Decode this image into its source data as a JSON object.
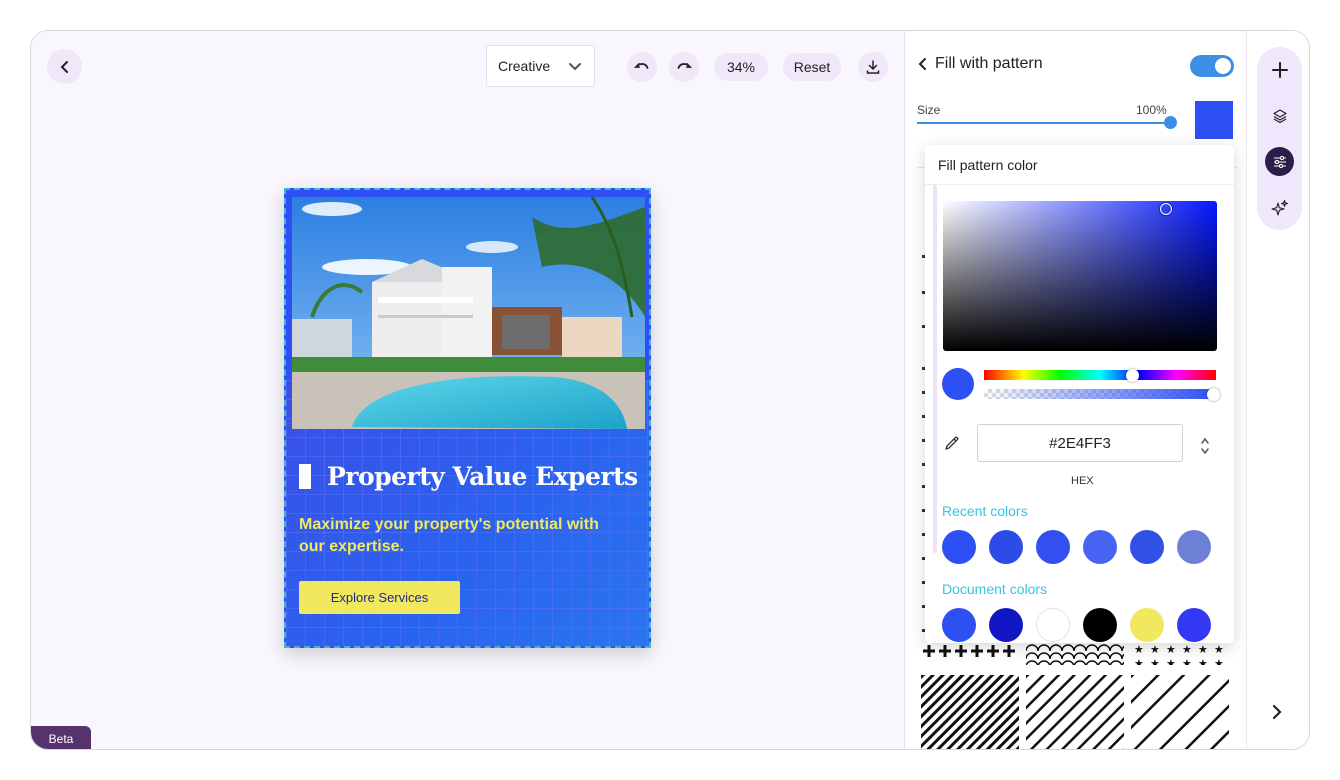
{
  "toolbar": {
    "template_select": "Creative",
    "zoom": "34%",
    "reset_label": "Reset"
  },
  "design": {
    "headline": "Property Value Experts",
    "subtitle": "Maximize your property's potential with our expertise.",
    "cta_label": "Explore Services",
    "accent_color": "#2e4ff3",
    "text_accent_color": "#f2e85f"
  },
  "beta_label": "Beta",
  "panel": {
    "title": "Fill with pattern",
    "toggle_on": true,
    "size_label": "Size",
    "size_value": "100%",
    "size_fraction": 1.0,
    "fill_color": "#2E4FF3"
  },
  "color_picker": {
    "title": "Fill pattern color",
    "hex_value": "#2E4FF3",
    "hex_label": "HEX",
    "recent_label": "Recent colors",
    "recent_colors": [
      "#2e4ff3",
      "#2b4ce6",
      "#334ff0",
      "#4763f4",
      "#3050e8",
      "#6c80d6"
    ],
    "document_label": "Document colors",
    "document_colors": [
      "#2e4ff3",
      "#1116c4",
      "#ffffff",
      "#000000",
      "#f2e85f",
      "#3338f5"
    ]
  },
  "icons": {
    "back": "chevron-left-icon",
    "undo": "undo-icon",
    "redo": "redo-icon",
    "download": "download-icon",
    "add": "plus-icon",
    "layers": "layers-icon",
    "adjust": "sliders-icon",
    "ai": "sparkles-icon",
    "next": "chevron-right-icon"
  }
}
